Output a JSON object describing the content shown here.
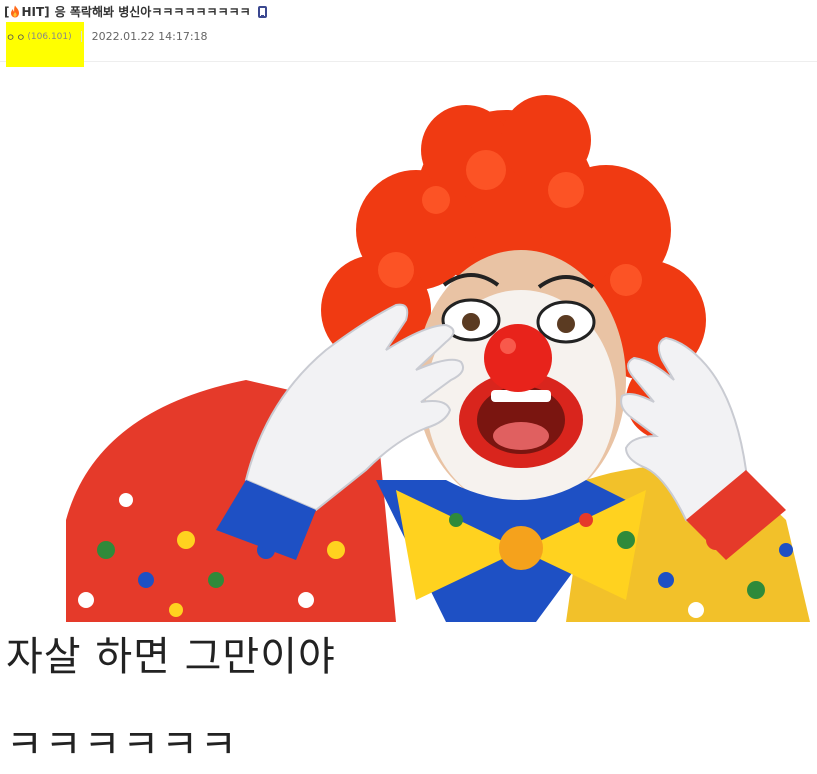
{
  "post": {
    "hit_open": "[",
    "hit_label": "HIT]",
    "title": "응 폭락해봐 병신아ㅋㅋㅋㅋㅋㅋㅋㅋㅋ",
    "writer_nick": "ㅇㅇ",
    "writer_ip": "(106.101)",
    "date": "2022.01.22 14:17:18"
  },
  "content": {
    "line1": "자살 하면 그만이야",
    "line2": "ㅋㅋㅋㅋㅋㅋ"
  },
  "icons": {
    "hit": "flame-icon",
    "device": "mobile-icon"
  },
  "colors": {
    "highlight": "#ffff00",
    "mobile_icon": "#3b4890",
    "flame": "#ff6a1a"
  }
}
